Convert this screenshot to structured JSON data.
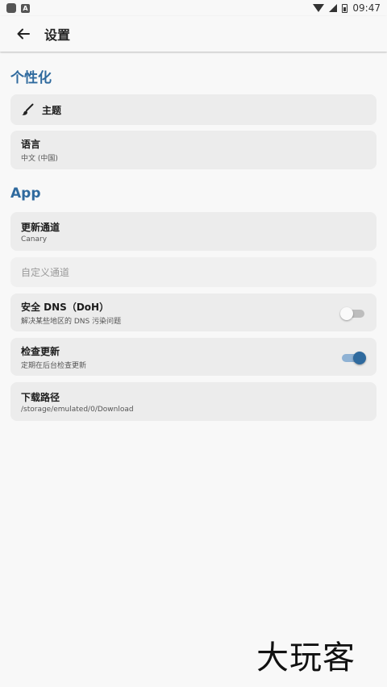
{
  "status_bar": {
    "time": "09:47",
    "app_icon_letter": "A"
  },
  "app_bar": {
    "title": "设置"
  },
  "sections": {
    "personalization": "个性化",
    "app": "App"
  },
  "items": {
    "theme": {
      "title": "主题"
    },
    "language": {
      "title": "语言",
      "subtitle": "中文 (中国)"
    },
    "update_channel": {
      "title": "更新通道",
      "subtitle": "Canary"
    },
    "custom_channel": {
      "placeholder": "自定义通道"
    },
    "secure_dns": {
      "title": "安全 DNS（DoH）",
      "subtitle": "解决某些地区的 DNS 污染问题",
      "enabled": false
    },
    "check_updates": {
      "title": "检查更新",
      "subtitle": "定期在后台检查更新",
      "enabled": true
    },
    "download_path": {
      "title": "下载路径",
      "subtitle": "/storage/emulated/0/Download"
    }
  },
  "watermark": "大玩客",
  "colors": {
    "accent": "#2f6a9e",
    "card": "#ececec",
    "background": "#f8f8f8"
  }
}
